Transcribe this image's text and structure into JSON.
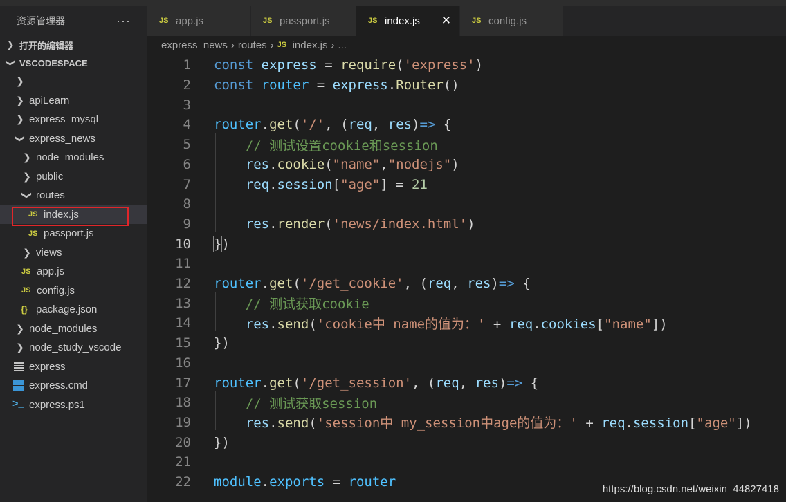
{
  "explorer": {
    "title": "资源管理器",
    "more": "···",
    "open_editors": "打开的编辑器",
    "workspace": "VSCODESPACE"
  },
  "tree": [
    {
      "label": "",
      "icon": "folder-chevron"
    },
    {
      "label": "apiLearn",
      "icon": "folder-chevron"
    },
    {
      "label": "express_mysql",
      "icon": "folder-chevron"
    },
    {
      "label": "express_news",
      "icon": "folder-chevron-open"
    },
    {
      "label": "node_modules",
      "icon": "folder-chevron"
    },
    {
      "label": "public",
      "icon": "folder-chevron"
    },
    {
      "label": "routes",
      "icon": "folder-chevron-open"
    },
    {
      "label": "index.js",
      "icon": "js-file"
    },
    {
      "label": "passport.js",
      "icon": "js-file"
    },
    {
      "label": "views",
      "icon": "folder-chevron"
    },
    {
      "label": "app.js",
      "icon": "js-file"
    },
    {
      "label": "config.js",
      "icon": "js-file"
    },
    {
      "label": "package.json",
      "icon": "json-file"
    },
    {
      "label": "node_modules",
      "icon": "folder-chevron"
    },
    {
      "label": "node_study_vscode",
      "icon": "folder-chevron"
    },
    {
      "label": "express",
      "icon": "text-file"
    },
    {
      "label": "express.cmd",
      "icon": "windows-file"
    },
    {
      "label": "express.ps1",
      "icon": "powershell-file"
    }
  ],
  "tabs": [
    {
      "label": "app.js",
      "icon": "JS"
    },
    {
      "label": "passport.js",
      "icon": "JS"
    },
    {
      "label": "index.js",
      "icon": "JS",
      "close": "✕"
    },
    {
      "label": "config.js",
      "icon": "JS"
    }
  ],
  "breadcrumb": {
    "parts": [
      "express_news",
      "routes",
      "index.js",
      "..."
    ],
    "sep": "›",
    "file_icon": "JS"
  },
  "editor": {
    "active_line": 10,
    "line_numbers": [
      "1",
      "2",
      "3",
      "4",
      "5",
      "6",
      "7",
      "8",
      "9",
      "10",
      "11",
      "12",
      "13",
      "14",
      "15",
      "16",
      "17",
      "18",
      "19",
      "20",
      "21",
      "22"
    ]
  },
  "watermark": "https://blog.csdn.net/weixin_44827418",
  "colors": {
    "keyword": "#569cd6",
    "variable": "#4fc1ff",
    "property": "#9cdcfe",
    "function": "#dcdcaa",
    "string": "#ce9178",
    "comment": "#6a9955",
    "number": "#b5cea8",
    "selection_border": "#e0262a"
  }
}
